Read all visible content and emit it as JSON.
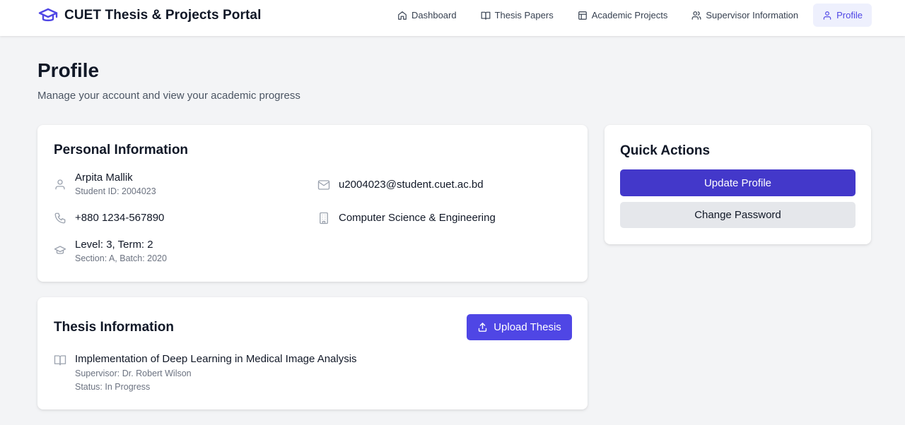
{
  "navbar": {
    "brand_icon": "graduation-cap-icon",
    "brand_title": "CUET Thesis & Projects Portal",
    "items": [
      {
        "label": "Dashboard",
        "icon": "home-icon"
      },
      {
        "label": "Thesis Papers",
        "icon": "book-icon"
      },
      {
        "label": "Academic Projects",
        "icon": "layout-icon"
      },
      {
        "label": "Supervisor Information",
        "icon": "users-icon"
      },
      {
        "label": "Profile",
        "icon": "user-icon",
        "active": true
      }
    ]
  },
  "page": {
    "title": "Profile",
    "subtitle": "Manage your account and view your academic progress"
  },
  "personal": {
    "heading": "Personal Information",
    "name": "Arpita Mallik",
    "student_id": "Student ID: 2004023",
    "email": "u2004023@student.cuet.ac.bd",
    "phone": "+880 1234-567890",
    "department": "Computer Science & Engineering",
    "level_term": "Level: 3, Term: 2",
    "section_batch": "Section: A, Batch: 2020"
  },
  "thesis": {
    "heading": "Thesis Information",
    "upload_label": "Upload Thesis",
    "title": "Implementation of Deep Learning in Medical Image Analysis",
    "supervisor": "Supervisor: Dr. Robert Wilson",
    "status": "Status: In Progress"
  },
  "actions": {
    "heading": "Quick Actions",
    "update_label": "Update Profile",
    "password_label": "Change Password"
  },
  "colors": {
    "accent": "#4f46e5",
    "primary_button": "#4338ca",
    "secondary_button": "#e5e7eb",
    "background": "#f3f4f6"
  }
}
